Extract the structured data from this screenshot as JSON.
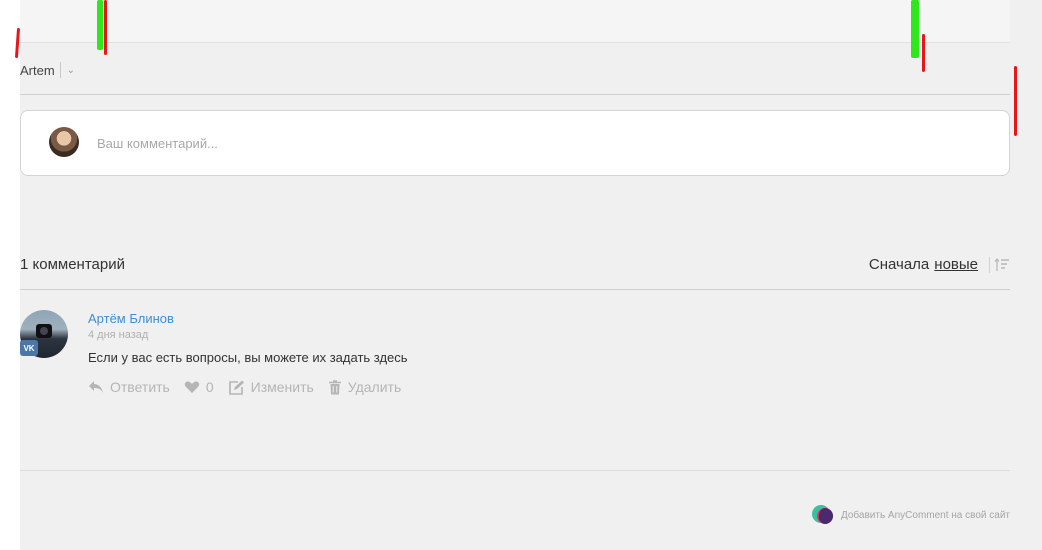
{
  "user": {
    "name": "Artem"
  },
  "form": {
    "placeholder": "Ваш комментарий..."
  },
  "comments_header": {
    "count_label": "1 комментарий",
    "sort_prefix": "Сначала",
    "sort_value": "новые"
  },
  "comments": [
    {
      "author": "Артём Блинов",
      "date": "4 дня назад",
      "text": "Если у вас есть вопросы, вы можете их задать здесь",
      "badge": "VK",
      "actions": {
        "reply": "Ответить",
        "likes": "0",
        "edit": "Изменить",
        "delete": "Удалить"
      }
    }
  ],
  "footer": {
    "link": "Добавить AnyComment на свой сайт"
  },
  "colors": {
    "link": "#3d8fd6",
    "muted": "#b5b5b5",
    "vk": "#4a76a8",
    "scribble_red": "#e8151b",
    "scribble_green": "#2de81a"
  }
}
